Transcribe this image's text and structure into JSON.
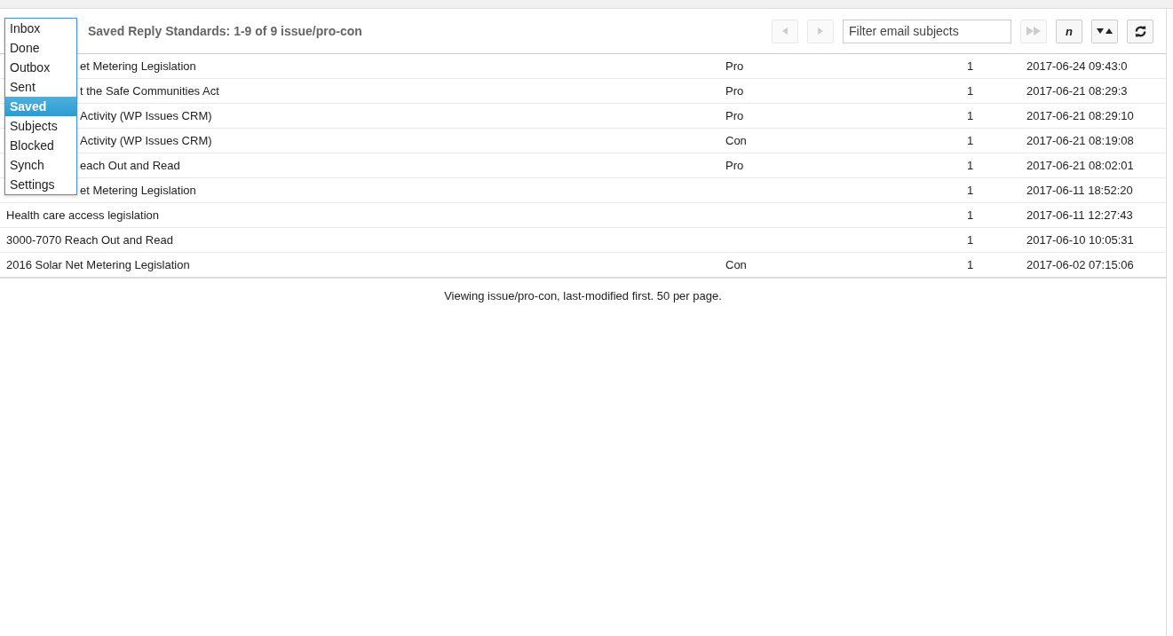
{
  "menu": {
    "items": [
      {
        "label": "Inbox",
        "selected": false
      },
      {
        "label": "Done",
        "selected": false
      },
      {
        "label": "Outbox",
        "selected": false
      },
      {
        "label": "Sent",
        "selected": false
      },
      {
        "label": "Saved",
        "selected": true
      },
      {
        "label": "Subjects",
        "selected": false
      },
      {
        "label": "Blocked",
        "selected": false
      },
      {
        "label": "Synch",
        "selected": false
      },
      {
        "label": "Settings",
        "selected": false
      }
    ]
  },
  "header": {
    "title": "Saved Reply Standards: 1-9 of 9 issue/pro-con"
  },
  "toolbar": {
    "buttons": [
      {
        "kind": "prev",
        "disabled": true
      },
      {
        "kind": "next",
        "disabled": true
      },
      {
        "kind": "filter",
        "placeholder": "Filter email subjects"
      },
      {
        "kind": "forward",
        "disabled": true
      },
      {
        "kind": "text",
        "label": "n",
        "disabled": false
      },
      {
        "kind": "sort",
        "disabled": false
      },
      {
        "kind": "refresh",
        "disabled": false
      }
    ]
  },
  "table": {
    "rows": [
      {
        "subject": "et Metering Legislation",
        "stance": "Pro",
        "count": "1",
        "modified": "2017-06-24 09:43:0"
      },
      {
        "subject": "t the Safe Communities Act",
        "stance": "Pro",
        "count": "1",
        "modified": "2017-06-21 08:29:3"
      },
      {
        "subject": "Activity (WP Issues CRM)",
        "stance": "Pro",
        "count": "1",
        "modified": "2017-06-21 08:29:10"
      },
      {
        "subject": "Activity (WP Issues CRM)",
        "stance": "Con",
        "count": "1",
        "modified": "2017-06-21 08:19:08"
      },
      {
        "subject": "each Out and Read",
        "stance": "Pro",
        "count": "1",
        "modified": "2017-06-21 08:02:01"
      },
      {
        "subject": "et Metering Legislation",
        "count": "1",
        "modified": "2017-06-11 18:52:20"
      },
      {
        "subject": "Health care access legislation",
        "count": "1",
        "modified": "2017-06-11 12:27:43"
      },
      {
        "subject": "3000-7070 Reach Out and Read",
        "count": "1",
        "modified": "2017-06-10 10:05:31"
      },
      {
        "subject": "2016 Solar Net Metering Legislation",
        "stance": "Con",
        "count": "1",
        "modified": "2017-06-02 07:15:06"
      }
    ]
  },
  "footer": {
    "text": "Viewing issue/pro-con, last-modified first. 50 per page."
  }
}
